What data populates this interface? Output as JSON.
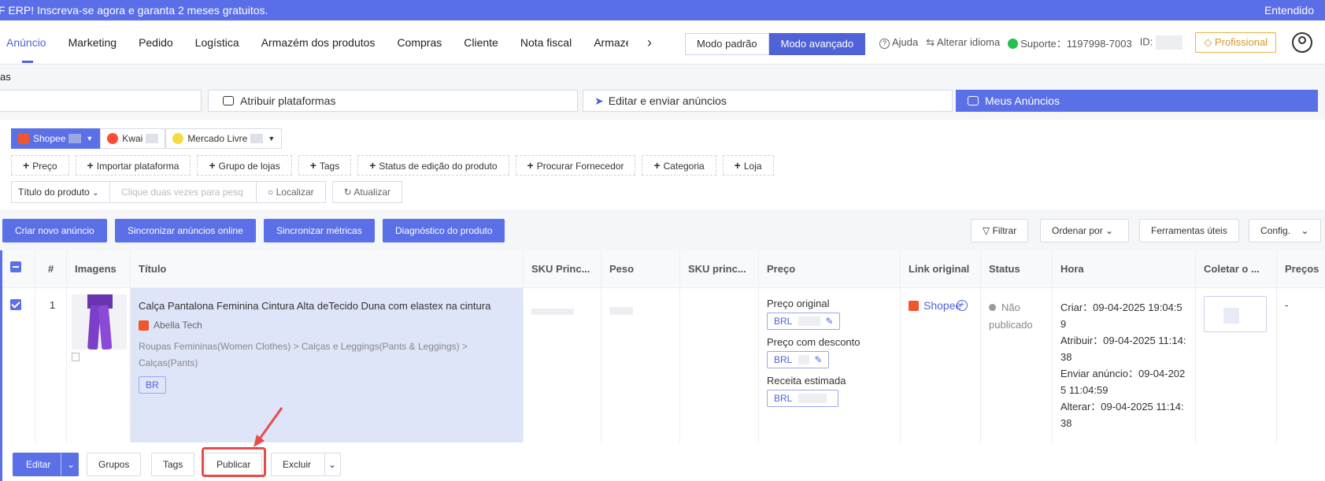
{
  "banner": {
    "text": "F ERP! Inscreva-se agora e garanta 2 meses gratuitos.",
    "dismiss_label": "Entendido"
  },
  "nav": {
    "tabs": [
      "Anúncio",
      "Marketing",
      "Pedido",
      "Logística",
      "Armazém dos produtos",
      "Compras",
      "Cliente",
      "Nota fiscal",
      "Armazém"
    ],
    "active_tab": "Anúncio",
    "more_icon": "chevron-right-icon",
    "mode_standard": "Modo padrão",
    "mode_advanced": "Modo avançado",
    "help_label": "Ajuda",
    "language_label": "Alterar idioma",
    "support_label": "Suporte：1197998-7003",
    "id_label": "ID:",
    "plan_label": "Profissional"
  },
  "breadcrumb": "as",
  "steps": {
    "assign": "Atribuir plataformas",
    "edit_send": "Editar e enviar anúncios",
    "my_listings": "Meus Anúncios"
  },
  "platforms": [
    {
      "name": "Shopee",
      "color": "#f0552d",
      "active": true
    },
    {
      "name": "Kwai",
      "color": "#ff4d35",
      "active": false
    },
    {
      "name": "Mercado Livre",
      "color": "#f7d945",
      "active": false
    }
  ],
  "filters": [
    "Preço",
    "Importar plataforma",
    "Grupo de lojas",
    "Tags",
    "Status de edição do produto",
    "Procurar Fornecedor",
    "Categoria",
    "Loja"
  ],
  "search": {
    "field_select": "Título do produto",
    "placeholder": "Clique duas vezes para pesq",
    "search_btn": "Localizar",
    "refresh_btn": "Atualizar"
  },
  "actions": {
    "create": "Criar novo anúncio",
    "sync_listings": "Sincronizar anúncios online",
    "sync_metrics": "Sincronizar métricas",
    "diagnosis": "Diagnóstico do produto",
    "filter": "Filtrar",
    "sort": "Ordenar por",
    "tools": "Ferramentas úteis",
    "config": "Config."
  },
  "table": {
    "headers": [
      "#",
      "Imagens",
      "Título",
      "SKU Princ...",
      "Peso",
      "SKU princ...",
      "Preço",
      "Link original",
      "Status",
      "Hora",
      "Coletar o ...",
      "Preços"
    ],
    "row": {
      "index": "1",
      "title": "Calça Pantalona Feminina Cintura Alta deTecido Duna com elastex na cintura",
      "shop": "Abella Tech",
      "category": "Roupas Femininas(Women Clothes) > Calças e Leggings(Pants & Leggings) > Calças(Pants)",
      "region": "BR",
      "price_original_label": "Preço original",
      "price_discount_label": "Preço com desconto",
      "price_estimated_label": "Receita estimada",
      "currency": "BRL",
      "link": "Shopee",
      "status": "Não publicado",
      "times": [
        "Criar：09-04-2025 19:04:59",
        "Atribuir：09-04-2025 11:14:38",
        "Enviar anúncio：09-04-2025 11:04:59",
        "Alterar：09-04-2025 11:14:38"
      ],
      "prices_cell": "-"
    }
  },
  "row_actions": {
    "edit": "Editar",
    "groups": "Grupos",
    "tags": "Tags",
    "publish": "Publicar",
    "delete": "Excluir"
  },
  "colors": {
    "primary": "#5b6fe6",
    "highlight": "#e74c4c"
  }
}
